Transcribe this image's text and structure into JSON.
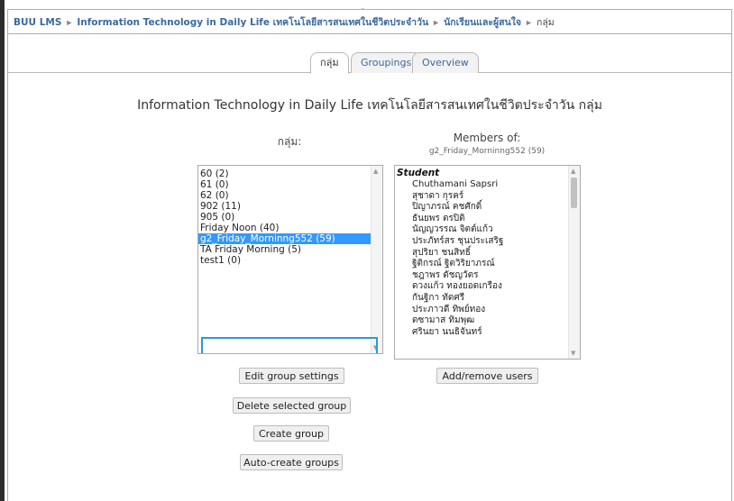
{
  "top_char": "ู",
  "breadcrumb": [
    {
      "label": "BUU LMS",
      "current": false
    },
    {
      "label": "Information Technology in Daily Life เทคโนโลยีสารสนเทศในชีวิตประจำวัน",
      "current": false
    },
    {
      "label": "นักเรียนและผู้สนใจ",
      "current": false
    },
    {
      "label": "กลุ่ม",
      "current": true
    }
  ],
  "breadcrumb_separator": "►",
  "tabs": [
    {
      "label": "กลุ่ม",
      "active": true
    },
    {
      "label": "Groupings",
      "active": false
    },
    {
      "label": "Overview",
      "active": false
    }
  ],
  "heading": "Information Technology in Daily Life เทคโนโลยีสารสนเทศในชีวิตประจำวัน กลุ่ม",
  "groups_panel": {
    "title": "กลุ่ม:",
    "items": [
      {
        "label": "60 (2)",
        "selected": false
      },
      {
        "label": "61 (0)",
        "selected": false
      },
      {
        "label": "62 (0)",
        "selected": false
      },
      {
        "label": "902 (11)",
        "selected": false
      },
      {
        "label": "905 (0)",
        "selected": false
      },
      {
        "label": "Friday Noon (40)",
        "selected": false
      },
      {
        "label": "g2_Friday_Morninng552 (59)",
        "selected": true
      },
      {
        "label": "TA Friday Morning (5)",
        "selected": false
      },
      {
        "label": "test1 (0)",
        "selected": false
      }
    ]
  },
  "members_panel": {
    "title": "Members of:",
    "subtitle": "g2_Friday_Morninng552 (59)",
    "role": "Student",
    "members": [
      "Chuthamani Sapsri",
      "สุชาดา กุรคร์",
      "ปิญาภรณ์ คชศักดิ์",
      "ธันยพร ตรปิติ",
      "นัญญวรรณ จิตต์แก้ว",
      "ประภัทร์สร ชุนประเสริฐ",
      "สุปริยา ชนสิทธิ์",
      "ฐิติกรณ์ ฐิตวิริยาภรณ์",
      "ชฎาพร ดัชญวัตร",
      "ดวงแก้ว ทองยอดเกรือง",
      "กันฐิกา ทัดศรี",
      "ประภาวดี ทิพย์ทอง",
      "ดซามาส ทิมพุฒ",
      "ศรินยา นนธิจันทร์"
    ]
  },
  "buttons": {
    "edit_group": "Edit group settings",
    "delete_group": "Delete selected group",
    "create_group": "Create group",
    "auto_create": "Auto-create groups",
    "add_remove": "Add/remove users"
  }
}
